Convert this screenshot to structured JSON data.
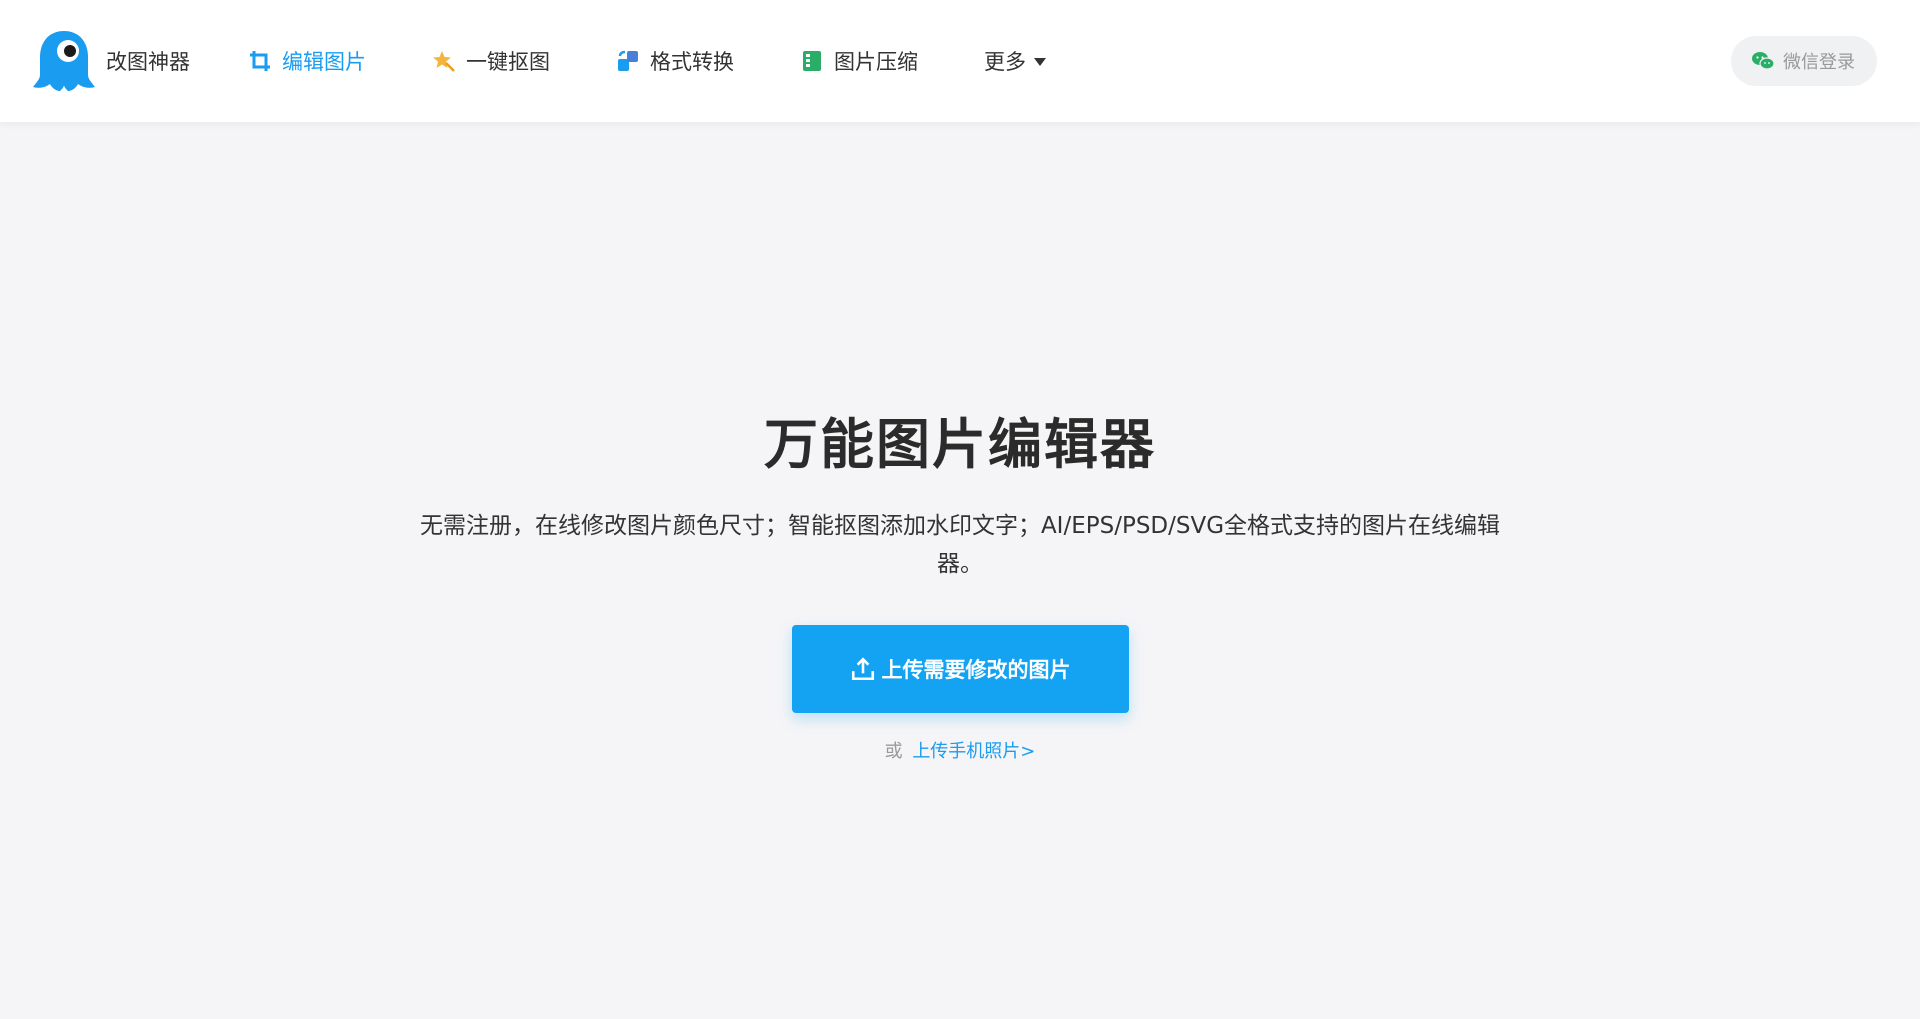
{
  "header": {
    "brand_name": "改图神器",
    "nav": [
      {
        "label": "编辑图片",
        "icon": "crop-icon",
        "active": true
      },
      {
        "label": "一键抠图",
        "icon": "magic-wand-icon",
        "active": false
      },
      {
        "label": "格式转换",
        "icon": "convert-icon",
        "active": false
      },
      {
        "label": "图片压缩",
        "icon": "compress-icon",
        "active": false
      }
    ],
    "more_label": "更多",
    "login_label": "微信登录"
  },
  "hero": {
    "title": "万能图片编辑器",
    "description": "无需注册，在线修改图片颜色尺寸；智能抠图添加水印文字；AI/EPS/PSD/SVG全格式支持的图片在线编辑器。",
    "upload_button": "上传需要修改的图片",
    "alt_prefix": "或",
    "alt_link": "上传手机照片>"
  },
  "colors": {
    "accent": "#1a9cf0",
    "button": "#14a3f3",
    "background": "#f5f5f7",
    "wechat": "#2aae67"
  }
}
